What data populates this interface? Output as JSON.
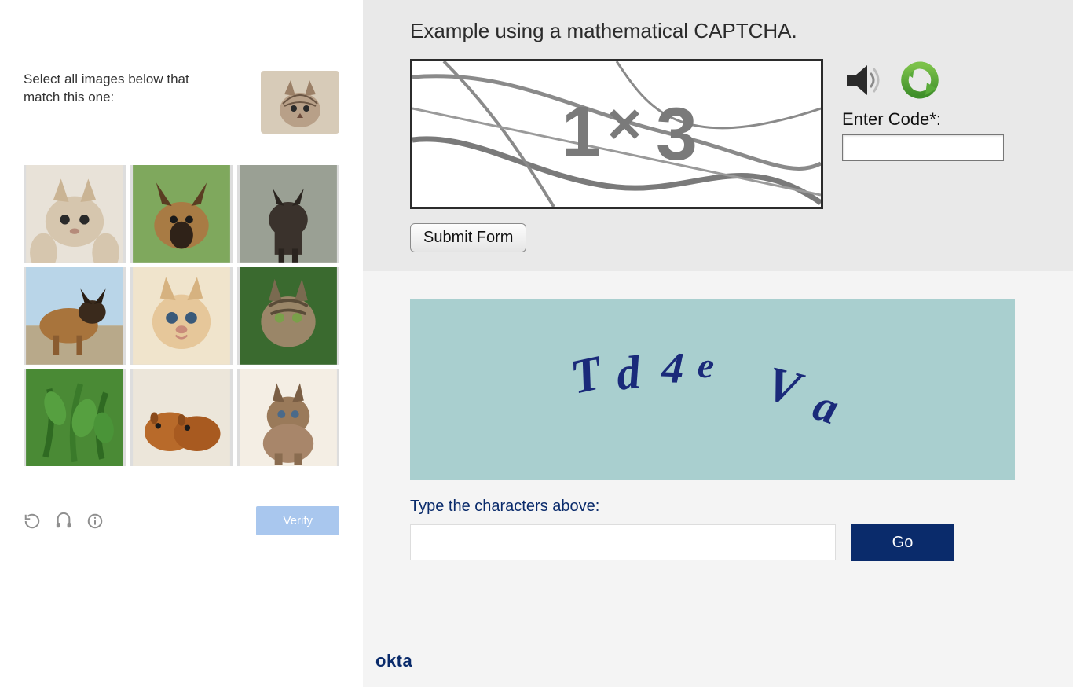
{
  "image_captcha": {
    "prompt": "Select all images below that match this one:",
    "reference": "cat",
    "grid": [
      "cat",
      "dog",
      "dog",
      "dog",
      "cat",
      "cat",
      "plant",
      "guinea-pig",
      "cat"
    ],
    "icons": {
      "refresh": "refresh",
      "audio": "audio",
      "info": "info"
    },
    "verify_label": "Verify"
  },
  "math_captcha": {
    "title": "Example using a mathematical CAPTCHA.",
    "expression": "1 × 3",
    "audio_icon": "speaker",
    "refresh_icon": "refresh",
    "enter_code_label": "Enter Code*:",
    "code_value": "",
    "submit_label": "Submit Form"
  },
  "text_captcha": {
    "distorted_text": "Td4e Va",
    "label": "Type the characters above:",
    "input_value": "",
    "go_label": "Go",
    "brand": "okta"
  }
}
